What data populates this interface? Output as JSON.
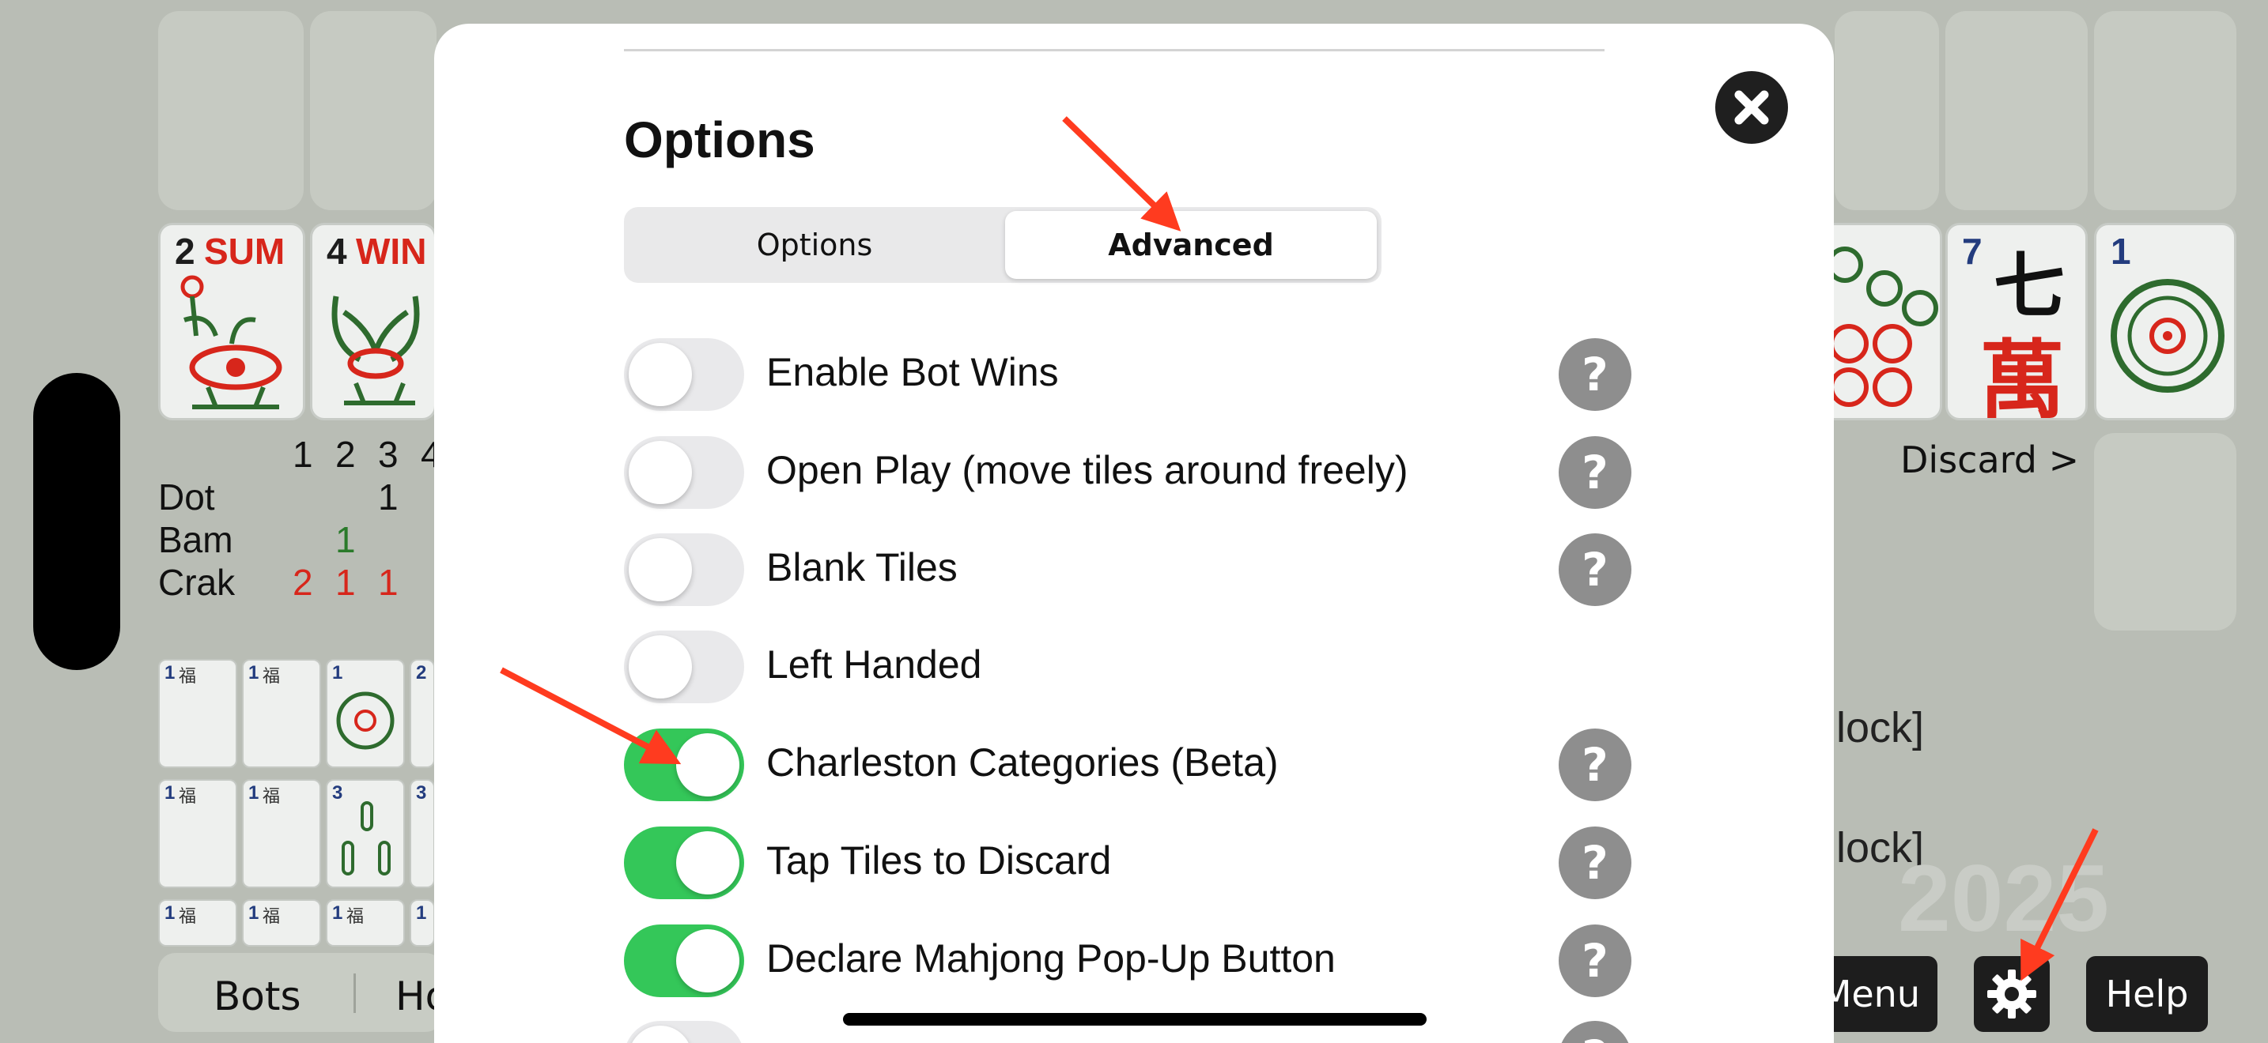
{
  "background": {
    "tiles_left": [
      {
        "index": "2",
        "word": "SUM"
      },
      {
        "index": "4",
        "word": "WIN"
      }
    ],
    "tiles_right": [
      {
        "index": "7",
        "glyph_top": "七",
        "glyph_bottom": "萬"
      },
      {
        "index": "1"
      }
    ],
    "count_table": {
      "columns": [
        "1",
        "2",
        "3",
        "4"
      ],
      "rows": [
        {
          "label": "Dot",
          "values": [
            {
              "col": 2,
              "value": "1",
              "color": "black"
            }
          ]
        },
        {
          "label": "Bam",
          "values": [
            {
              "col": 1,
              "value": "1",
              "color": "green"
            }
          ]
        },
        {
          "label": "Crak",
          "values": [
            {
              "col": 0,
              "value": "2",
              "color": "red"
            },
            {
              "col": 1,
              "value": "1",
              "color": "red"
            },
            {
              "col": 2,
              "value": "1",
              "color": "red"
            }
          ]
        }
      ]
    },
    "small_tiles": [
      {
        "index": "1",
        "glyph": "福"
      },
      {
        "index": "1",
        "glyph": "福"
      },
      {
        "index": "1",
        "glyph": ""
      },
      {
        "index": "2",
        "glyph": ""
      },
      {
        "index": "1",
        "glyph": "福"
      },
      {
        "index": "1",
        "glyph": "福"
      },
      {
        "index": "3",
        "glyph": ""
      },
      {
        "index": "3",
        "glyph": ""
      },
      {
        "index": "1",
        "glyph": "福"
      },
      {
        "index": "1",
        "glyph": "福"
      },
      {
        "index": "1",
        "glyph": "福"
      },
      {
        "index": "1",
        "glyph": "福"
      }
    ],
    "discard_label": "Discard >",
    "clock_lines": [
      "lock]",
      "lock]"
    ],
    "year_watermark": "2025",
    "bottom_bar": {
      "bots": "Bots",
      "partial": "Ho"
    },
    "menu_button": "Menu",
    "help_button": "Help",
    "settings_icon": "gear-icon"
  },
  "modal": {
    "title": "Options",
    "close_icon": "close-icon",
    "tabs": [
      {
        "label": "Options",
        "selected": false
      },
      {
        "label": "Advanced",
        "selected": true
      }
    ],
    "settings": [
      {
        "label": "Enable Bot Wins",
        "on": false,
        "help": "?"
      },
      {
        "label": "Open Play (move tiles around freely)",
        "on": false,
        "help": "?"
      },
      {
        "label": "Blank Tiles",
        "on": false,
        "help": "?"
      },
      {
        "label": "Left Handed",
        "on": false,
        "help": ""
      },
      {
        "label": "Charleston Categories (Beta)",
        "on": true,
        "help": "?"
      },
      {
        "label": "Tap Tiles to Discard",
        "on": true,
        "help": "?"
      },
      {
        "label": "Declare Mahjong Pop-Up Button",
        "on": true,
        "help": "?"
      },
      {
        "label": "",
        "on": false,
        "help": "?"
      }
    ]
  },
  "colors": {
    "toggle_on": "#34c759",
    "toggle_off": "#e9e9eb",
    "annotation_arrow": "#ff3b1f",
    "background": "#b9bdb5"
  }
}
